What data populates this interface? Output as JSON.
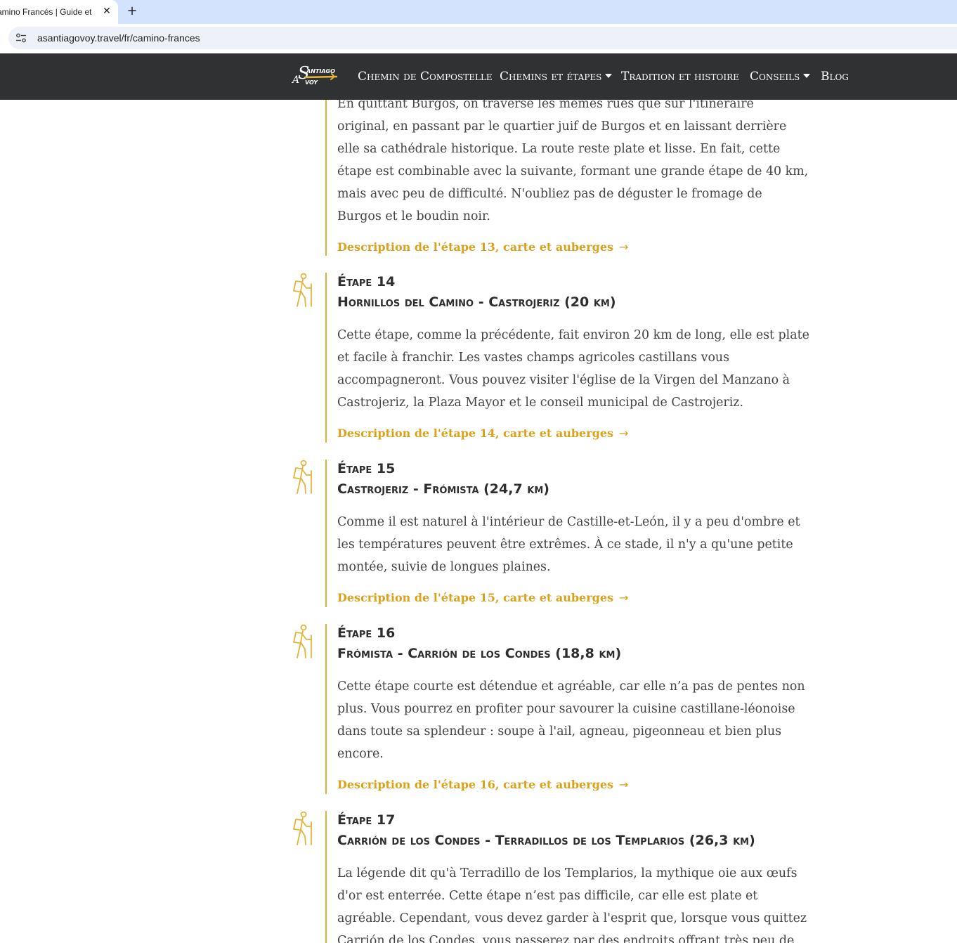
{
  "browser": {
    "tab_title": "amino Francés | Guide et é",
    "tab_close": "✕",
    "new_tab": "+",
    "url": "asantiagovoy.travel/fr/camino-frances"
  },
  "navbar": {
    "logo_text": "A Santiago voy",
    "items": [
      {
        "label": "Chemin de Compostelle",
        "dropdown": false
      },
      {
        "label": "Chemins et étapes",
        "dropdown": true
      },
      {
        "label": "Tradition et histoire",
        "dropdown": false
      },
      {
        "label": "Conseils",
        "dropdown": true
      },
      {
        "label": "Blog",
        "dropdown": false
      }
    ]
  },
  "colors": {
    "accent": "#d9a21c",
    "navbar_bg": "#2f3133"
  },
  "stages": [
    {
      "label": "",
      "title": "",
      "description": "En quittant Burgos, on traverse les mêmes rues que sur l'itinéraire original, en passant par le quartier juif de Burgos et en laissant derrière elle sa cathédrale historique. La route reste plate et lisse. En fait, cette étape est combinable avec la suivante, formant une grande étape de 40 km, mais avec peu de difficulté. N'oubliez pas de déguster le fromage de Burgos et le boudin noir.",
      "link": "Description de l'étape 13, carte et auberges"
    },
    {
      "label": "Étape 14",
      "title": "Hornillos del Camino - Castrojeriz (20 km)",
      "description": "Cette étape, comme la précédente, fait environ 20 km de long, elle est plate et facile à franchir. Les vastes champs agricoles castillans vous accompagneront. Vous pouvez visiter l'église de la Virgen del Manzano à Castrojeriz, la Plaza Mayor et le conseil municipal de Castrojeriz.",
      "link": "Description de l'étape 14, carte et auberges"
    },
    {
      "label": "Étape 15",
      "title": "Castrojeriz - Frómista (24,7 km)",
      "description": "Comme il est naturel à l'intérieur de Castille-et-León, il y a peu d'ombre et les températures peuvent être extrêmes. À ce stade, il n'y a qu'une petite montée, suivie de longues plaines.",
      "link": "Description de l'étape 15, carte et auberges"
    },
    {
      "label": "Étape 16",
      "title": "Frómista - Carrión de los Condes (18,8 km)",
      "description": "Cette étape courte est détendue et agréable, car elle n’a pas de pentes non plus. Vous pourrez en profiter pour savourer la cuisine castillane-léonoise dans toute sa splendeur : soupe à l'ail, agneau, pigeonneau et bien plus encore.",
      "link": "Description de l'étape 16, carte et auberges"
    },
    {
      "label": "Étape 17",
      "title": "Carrión de los Condes - Terradillos de los Templarios (26,3 km)",
      "description": "La légende dit qu'à Terradillo de los Templarios, la mythique oie aux œufs d'or est enterrée. Cette étape n’est pas difficile, car elle est plate et agréable. Cependant, vous devez garder à l'esprit que, lorsque vous quittez Carrión de los Condes, vous passerez par des endroits offrant très peu de services (par",
      "link": ""
    }
  ],
  "link_arrow": "→"
}
